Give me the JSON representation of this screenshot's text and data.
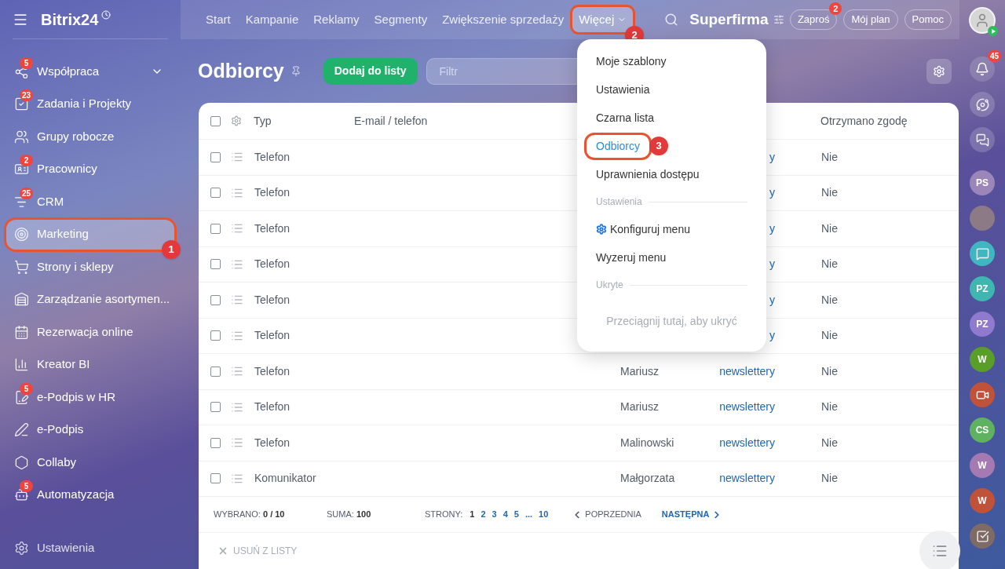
{
  "logo": {
    "title": "Bitrix24"
  },
  "sidebar": {
    "items": [
      {
        "label": "Współpraca",
        "badge": "5",
        "expandable": true,
        "selected": false
      },
      {
        "label": "Zadania i Projekty",
        "badge": "23",
        "selected": false
      },
      {
        "label": "Grupy robocze",
        "selected": false
      },
      {
        "label": "Pracownicy",
        "badge": "2",
        "selected": false
      },
      {
        "label": "CRM",
        "badge": "25",
        "selected": false
      },
      {
        "label": "Marketing",
        "selected": true,
        "callout": "1"
      },
      {
        "label": "Strony i sklepy",
        "selected": false
      },
      {
        "label": "Zarządzanie asortymen...",
        "selected": false
      },
      {
        "label": "Rezerwacja online",
        "selected": false
      },
      {
        "label": "Kreator BI",
        "selected": false
      },
      {
        "label": "e-Podpis w HR",
        "badge": "5",
        "selected": false
      },
      {
        "label": "e-Podpis",
        "selected": false
      },
      {
        "label": "Collaby",
        "selected": false
      },
      {
        "label": "Automatyzacja",
        "badge": "5",
        "selected": false
      }
    ],
    "settings": "Ustawienia"
  },
  "nav": {
    "items": [
      {
        "label": "Start",
        "selected": false
      },
      {
        "label": "Kampanie",
        "selected": false
      },
      {
        "label": "Reklamy",
        "selected": false
      },
      {
        "label": "Segmenty",
        "selected": false
      },
      {
        "label": "Zwiększenie sprzedaży",
        "selected": false
      },
      {
        "label": "Więcej",
        "selected": true,
        "dropdown": true,
        "callout": "2"
      }
    ]
  },
  "company": "Superfirma",
  "top_buttons": [
    {
      "label": "Zaproś",
      "badge": "2"
    },
    {
      "label": "Mój plan"
    },
    {
      "label": "Pomoc"
    }
  ],
  "page": {
    "title": "Odbiorcy",
    "add_button": "Dodaj do listy",
    "filter": {
      "placeholder": "Filtr"
    }
  },
  "table": {
    "all_checked": false,
    "columns": [
      "Typ",
      "E-mail / telefon",
      "",
      "",
      "Otrzymano zgodę"
    ],
    "rows": [
      {
        "type": "Telefon",
        "column_4": "y",
        "consent": "Nie",
        "checked": false
      },
      {
        "type": "Telefon",
        "column_4": "y",
        "consent": "Nie",
        "checked": false
      },
      {
        "type": "Telefon",
        "column_4": "y",
        "consent": "Nie",
        "checked": false
      },
      {
        "type": "Telefon",
        "column_4": "y",
        "consent": "Nie",
        "checked": false
      },
      {
        "type": "Telefon",
        "column_4": "y",
        "consent": "Nie",
        "checked": false
      },
      {
        "type": "Telefon",
        "column_4": "y",
        "consent": "Nie",
        "checked": false
      },
      {
        "type": "Telefon",
        "column_3": "Mariusz",
        "column_4": "newslettery",
        "consent": "Nie",
        "checked": false
      },
      {
        "type": "Telefon",
        "column_3": "Mariusz",
        "column_4": "newslettery",
        "consent": "Nie",
        "checked": false
      },
      {
        "type": "Telefon",
        "column_3": "Malinowski",
        "column_4": "newslettery",
        "consent": "Nie",
        "checked": false
      },
      {
        "type": "Komunikator",
        "column_3": "Małgorzata",
        "column_4": "newslettery",
        "consent": "Nie",
        "checked": false
      }
    ]
  },
  "footer": {
    "selected_label": "WYBRANO:",
    "selected_value": "0 / 10",
    "total_label": "SUMA:",
    "total_value": "100",
    "pages_label": "STRONY:",
    "pages": [
      {
        "label": "1",
        "selected": true
      },
      {
        "label": "2",
        "selected": false
      },
      {
        "label": "3",
        "selected": false
      },
      {
        "label": "4",
        "selected": false
      },
      {
        "label": "5",
        "selected": false
      },
      {
        "label": "...",
        "selected": false
      },
      {
        "label": "10",
        "selected": false
      }
    ],
    "prev": "POPRZEDNIA",
    "next": "NASTĘPNA",
    "remove": "USUŃ Z LISTY"
  },
  "menu": {
    "items": [
      {
        "kind": "item",
        "label": "Moje szablony",
        "selected": false
      },
      {
        "kind": "item",
        "label": "Ustawienia",
        "selected": false
      },
      {
        "kind": "item",
        "label": "Czarna lista",
        "selected": false
      },
      {
        "kind": "item",
        "label": "Odbiorcy",
        "selected": true,
        "callout": "3"
      },
      {
        "kind": "item",
        "label": "Uprawnienia dostępu",
        "selected": false
      },
      {
        "kind": "section",
        "label": "Ustawienia"
      },
      {
        "kind": "action",
        "label": "Konfiguruj menu",
        "selected": false
      },
      {
        "kind": "item",
        "label": "Wyzeruj menu",
        "selected": false
      },
      {
        "kind": "section",
        "label": "Ukryte"
      },
      {
        "kind": "hint",
        "label": "Przeciągnij tutaj, aby ukryć"
      }
    ]
  },
  "rail": {
    "notifications_badge": "45",
    "items": [
      {
        "kind": "copilot"
      },
      {
        "kind": "chat"
      },
      {
        "kind": "initials",
        "text": "PS",
        "color": "#9a86b8"
      },
      {
        "kind": "photo",
        "color": "#8c7a86"
      },
      {
        "kind": "message",
        "color": "#3fb6c2"
      },
      {
        "kind": "initials",
        "text": "PZ",
        "color": "#3fb7b0"
      },
      {
        "kind": "initials",
        "text": "PZ",
        "color": "#8f7ad0"
      },
      {
        "kind": "initials",
        "text": "W",
        "color": "#5a9e2a"
      },
      {
        "kind": "video",
        "color": "#c0523a"
      },
      {
        "kind": "initials",
        "text": "CS",
        "color": "#5fb360"
      },
      {
        "kind": "initials",
        "text": "W",
        "color": "#a57ab3"
      },
      {
        "kind": "initials",
        "text": "W",
        "color": "#c0523a"
      },
      {
        "kind": "tasks",
        "color": "#7f6b65"
      }
    ]
  }
}
